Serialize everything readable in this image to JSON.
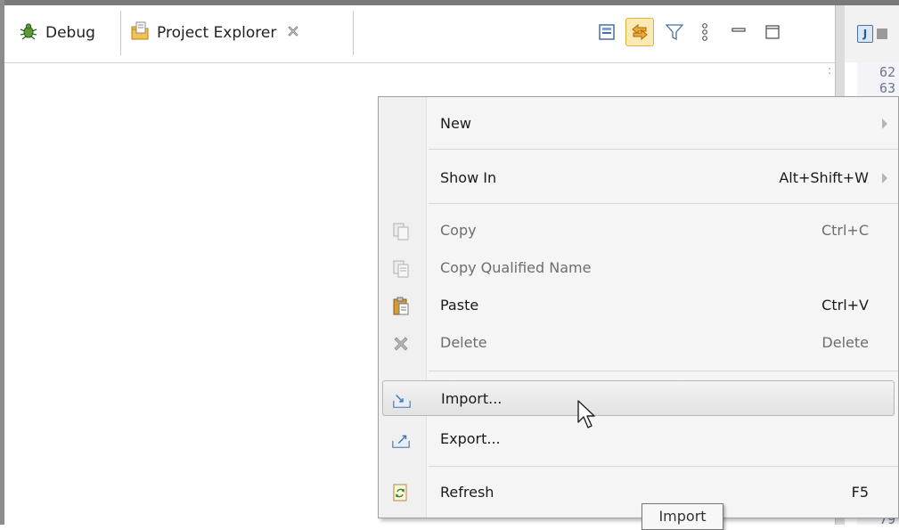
{
  "tabs": {
    "debug_label": "Debug",
    "project_explorer_label": "Project Explorer"
  },
  "editor": {
    "line_numbers": [
      "62",
      "63",
      "79"
    ]
  },
  "context_menu": {
    "items": [
      {
        "label": "New",
        "accelerator": "",
        "enabled": true,
        "submenu": true
      },
      {
        "label": "Show In",
        "accelerator": "Alt+Shift+W",
        "enabled": true,
        "submenu": true
      },
      {
        "label": "Copy",
        "accelerator": "Ctrl+C",
        "enabled": false,
        "icon": "copy-icon"
      },
      {
        "label": "Copy Qualified Name",
        "accelerator": "",
        "enabled": false,
        "icon": "copy-qualified-name-icon"
      },
      {
        "label": "Paste",
        "accelerator": "Ctrl+V",
        "enabled": true,
        "icon": "paste-icon"
      },
      {
        "label": "Delete",
        "accelerator": "Delete",
        "enabled": false,
        "icon": "delete-icon"
      },
      {
        "label": "Import...",
        "accelerator": "",
        "enabled": true,
        "highlighted": true,
        "icon": "import-icon"
      },
      {
        "label": "Export...",
        "accelerator": "",
        "enabled": true,
        "icon": "export-icon"
      },
      {
        "label": "Refresh",
        "accelerator": "F5",
        "enabled": true,
        "icon": "refresh-icon"
      }
    ]
  },
  "tooltip": {
    "text": "Import"
  },
  "colors": {
    "link_toggle_border": "#e3b33c",
    "link_toggle_fill": "#fbe9b3",
    "menu_background": "#f5f5f5",
    "disabled_text": "#6d6d6d"
  }
}
